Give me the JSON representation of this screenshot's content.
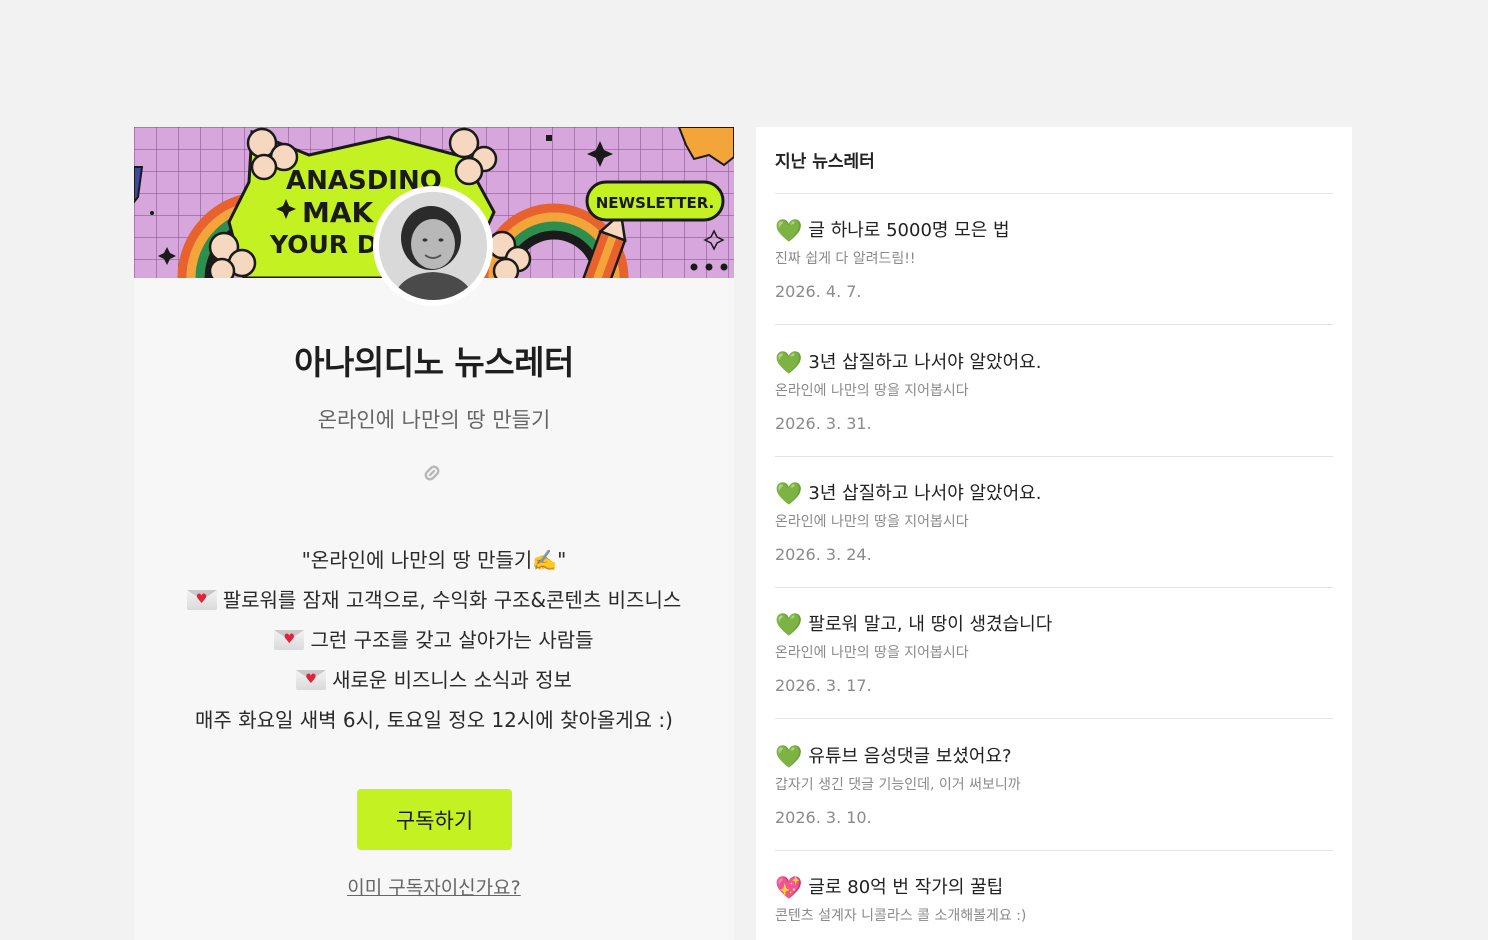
{
  "profile": {
    "banner_text_1": "ANASDINO",
    "banner_text_2": "MAK",
    "banner_text_3": "YOUR D",
    "banner_badge": "NEWSLETTER.",
    "title": "아나의디노 뉴스레터",
    "subtitle": "온라인에 나만의 땅 만들기",
    "link_icon": "link-icon",
    "description": [
      "\"온라인에 나만의 땅 만들기✍️\"",
      "팔로워를 잠재 고객으로, 수익화 구조&콘텐츠 비즈니스",
      "그런 구조를 갖고 살아가는 사람들",
      "새로운 비즈니스 소식과 정보",
      "매주 화요일 새벽 6시, 토요일 정오 12시에 찾아올게요 :)"
    ],
    "subscribe_label": "구독하기",
    "already_label": "이미 구독자이신가요?",
    "accent_color": "#c4f121"
  },
  "archive": {
    "header": "지난 뉴스레터",
    "items": [
      {
        "icon": "💚",
        "title": "글 하나로 5000명 모은 법",
        "subtitle": "진짜 쉽게 다 알려드림!!",
        "date": "2026. 4. 7."
      },
      {
        "icon": "💚",
        "title": "3년 삽질하고 나서야 알았어요.",
        "subtitle": "온라인에 나만의 땅을 지어봅시다",
        "date": "2026. 3. 31."
      },
      {
        "icon": "💚",
        "title": "3년 삽질하고 나서야 알았어요.",
        "subtitle": "온라인에 나만의 땅을 지어봅시다",
        "date": "2026. 3. 24."
      },
      {
        "icon": "💚",
        "title": "팔로워 말고, 내 땅이 생겼습니다",
        "subtitle": "온라인에 나만의 땅을 지어봅시다",
        "date": "2026. 3. 17."
      },
      {
        "icon": "💚",
        "title": "유튜브 음성댓글 보셨어요?",
        "subtitle": "갑자기 생긴 댓글 기능인데, 이거 써보니까",
        "date": "2026. 3. 10."
      },
      {
        "icon": "💖",
        "title": "글로 80억 번 작가의 꿀팁",
        "subtitle": "콘텐츠 설계자 니콜라스 콜 소개해볼게요 :)",
        "date": ""
      }
    ]
  }
}
